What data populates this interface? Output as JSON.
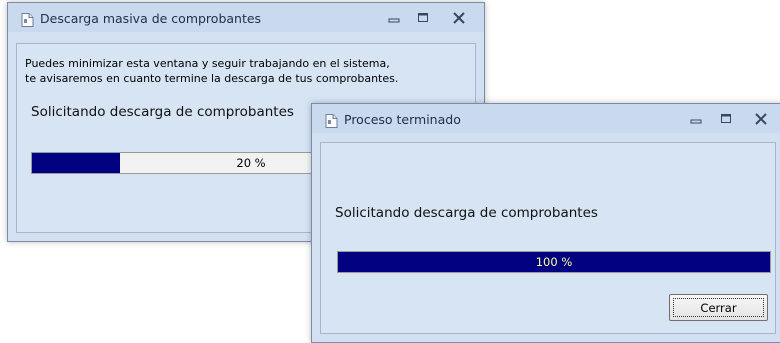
{
  "window1": {
    "title": "Descarga masiva de comprobantes",
    "message_line1": "Puedes minimizar esta ventana y seguir trabajando en el sistema,",
    "message_line2": "te avisaremos en cuanto termine la descarga de tus comprobantes.",
    "status": "Solicitando descarga de comprobantes",
    "progress_value": 0.2,
    "progress_label": "20 %"
  },
  "window2": {
    "title": "Proceso terminado",
    "status": "Solicitando descarga de comprobantes",
    "progress_value": 1.0,
    "progress_label": "100 %",
    "close_button_label": "Cerrar"
  },
  "colors": {
    "progress_fill": "#000080",
    "window_bg": "#d3e0f1",
    "pct_on_track": "#000000",
    "pct_on_fill": "#ffffa0"
  },
  "icons": [
    "document-icon",
    "minimize-icon",
    "maximize-icon",
    "close-icon"
  ]
}
